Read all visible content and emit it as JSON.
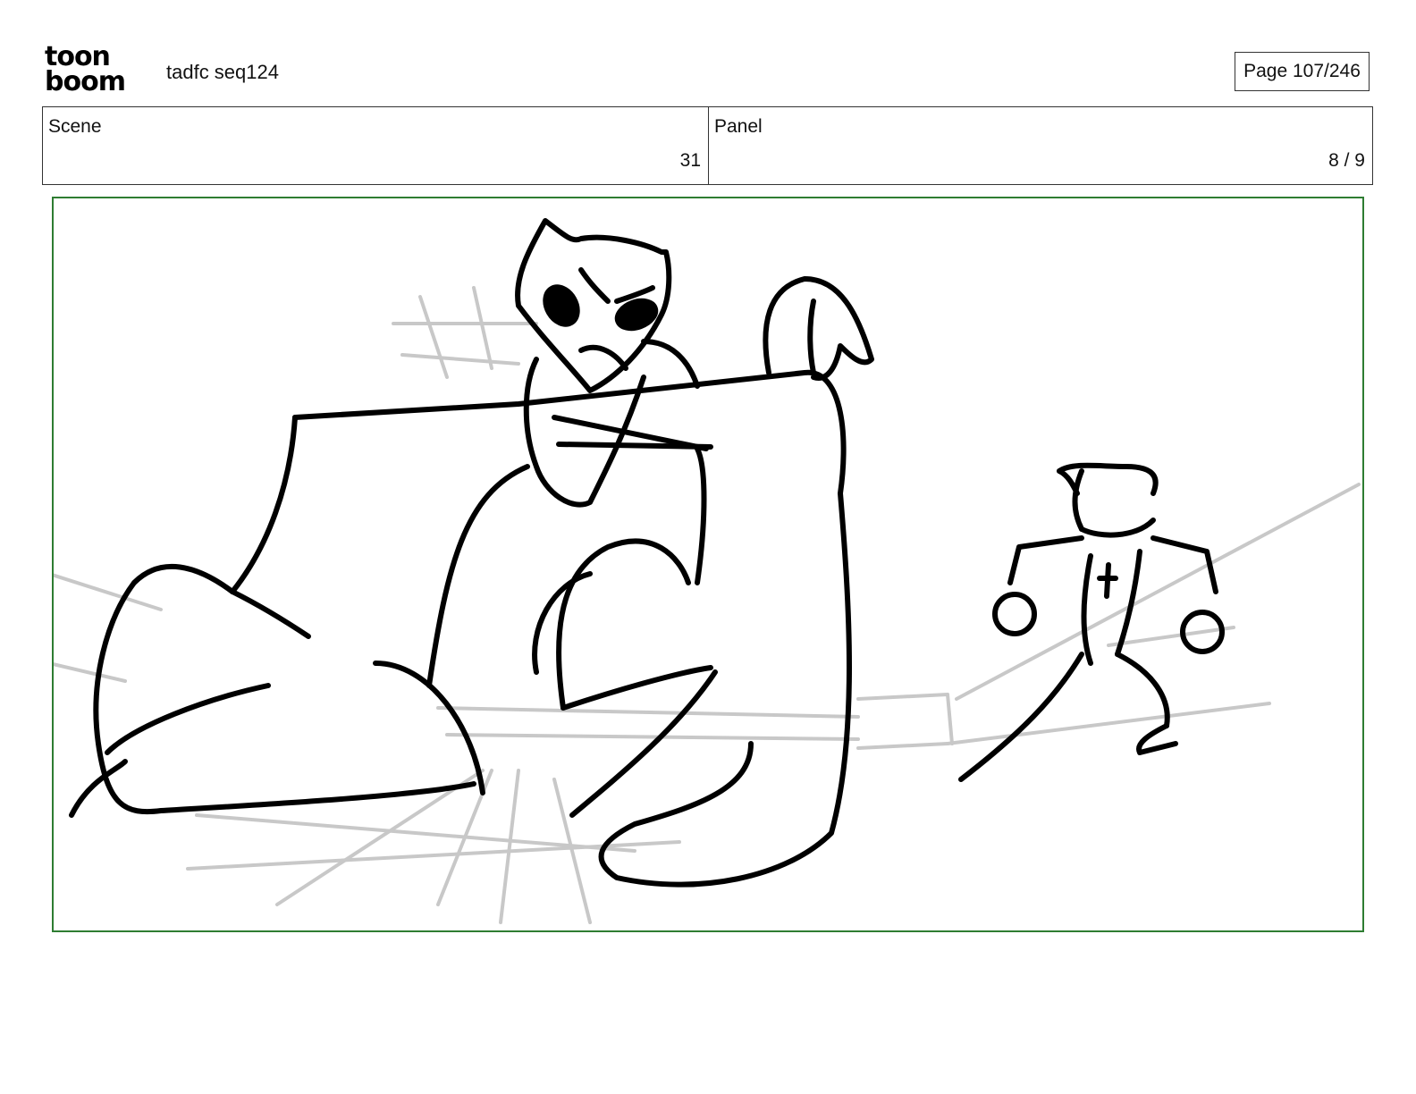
{
  "header": {
    "logo_line1": "toon",
    "logo_line2": "boom",
    "title": "tadfc seq124",
    "page": "Page 107/246"
  },
  "info": {
    "scene_label": "Scene",
    "scene_value": "31",
    "panel_label": "Panel",
    "panel_value": "8 / 9"
  },
  "colors": {
    "panel_border": "#2e7d32",
    "sketch_ink": "#000000",
    "sketch_guides": "#c8c8c8"
  }
}
